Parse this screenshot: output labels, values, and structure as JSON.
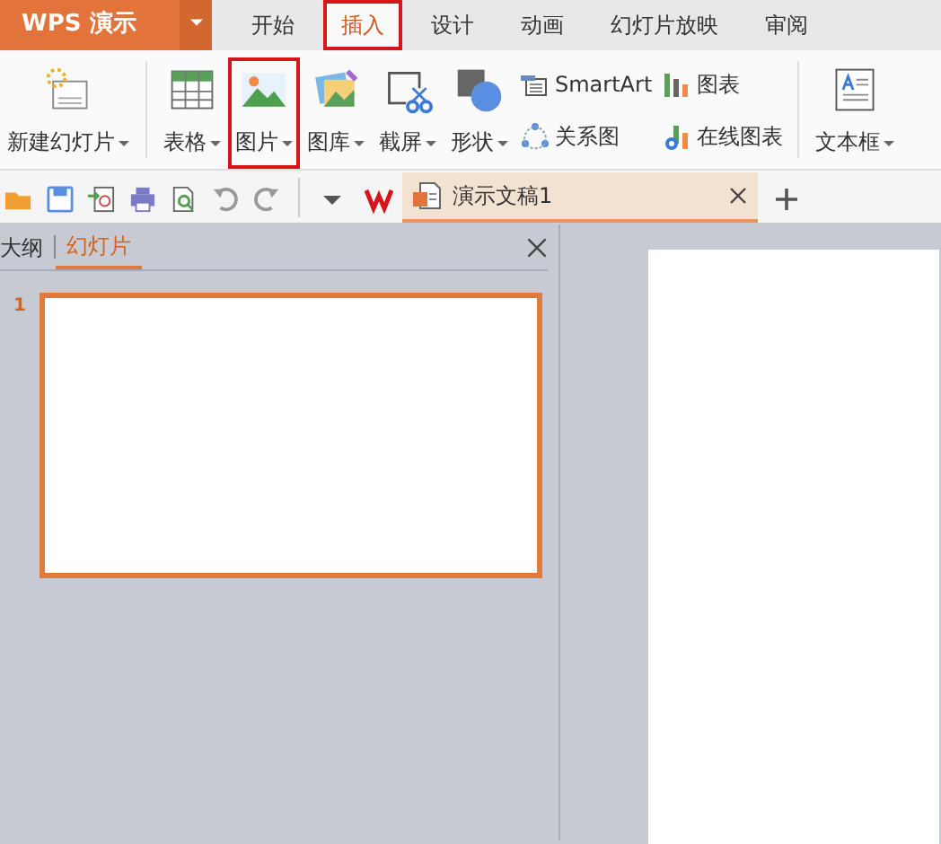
{
  "app": {
    "name": "WPS 演示"
  },
  "tabs": [
    {
      "label": "开始",
      "selected": false,
      "annotated": false
    },
    {
      "label": "插入",
      "selected": true,
      "annotated": true
    },
    {
      "label": "设计",
      "selected": false,
      "annotated": false
    },
    {
      "label": "动画",
      "selected": false,
      "annotated": false
    },
    {
      "label": "幻灯片放映",
      "selected": false,
      "annotated": false
    },
    {
      "label": "审阅",
      "selected": false,
      "annotated": false
    }
  ],
  "ribbon": [
    {
      "kind": "large",
      "label": "新建幻灯片",
      "dropdown": true,
      "annotated": false
    },
    {
      "kind": "separator"
    },
    {
      "kind": "large",
      "label": "表格",
      "dropdown": true,
      "annotated": false
    },
    {
      "kind": "large",
      "label": "图片",
      "dropdown": true,
      "annotated": true
    },
    {
      "kind": "large",
      "label": "图库",
      "dropdown": true,
      "annotated": false
    },
    {
      "kind": "large",
      "label": "截屏",
      "dropdown": true,
      "annotated": false
    },
    {
      "kind": "large",
      "label": "形状",
      "dropdown": true,
      "annotated": false
    },
    {
      "kind": "stack",
      "labels": [
        "SmartArt",
        "关系图"
      ]
    },
    {
      "kind": "stack",
      "labels": [
        "图表",
        "在线图表"
      ]
    },
    {
      "kind": "separator"
    },
    {
      "kind": "large",
      "label": "文本框",
      "dropdown": true,
      "annotated": false
    }
  ],
  "document_tabs": [
    {
      "title": "演示文稿1",
      "selected": true
    }
  ],
  "side_panel": {
    "tabs": [
      {
        "label": "大纲",
        "selected": false
      },
      {
        "label": "幻灯片",
        "selected": true
      }
    ],
    "slides": [
      {
        "number": "1",
        "selected": true
      }
    ]
  }
}
